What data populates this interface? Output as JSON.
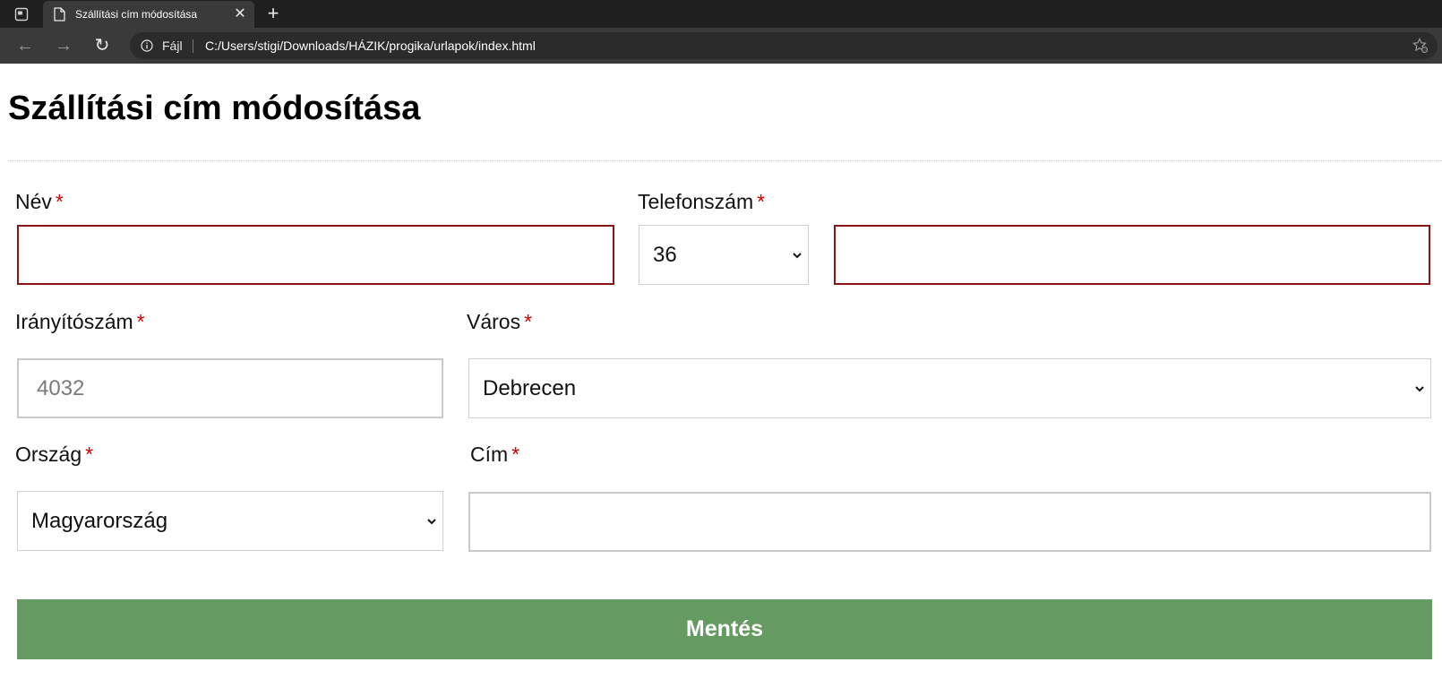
{
  "browser": {
    "tab_title": "Szállítási cím módosítása",
    "address_scheme": "Fájl",
    "address_url": "C:/Users/stigi/Downloads/HÁZIK/progika/urlapok/index.html"
  },
  "page": {
    "title": "Szállítási cím módosítása",
    "required_marker": "*"
  },
  "form": {
    "name": {
      "label": "Név",
      "value": ""
    },
    "phone": {
      "label": "Telefonszám",
      "country_code": "36",
      "value": ""
    },
    "zip": {
      "label": "Irányítószám",
      "placeholder": "4032",
      "value": ""
    },
    "city": {
      "label": "Város",
      "selected": "Debrecen"
    },
    "country": {
      "label": "Ország",
      "selected": "Magyarország"
    },
    "address": {
      "label": "Cím",
      "value": ""
    },
    "save_label": "Mentés"
  },
  "colors": {
    "save_button": "#659a61",
    "required": "#d40000",
    "invalid_border": "#8b1414"
  }
}
